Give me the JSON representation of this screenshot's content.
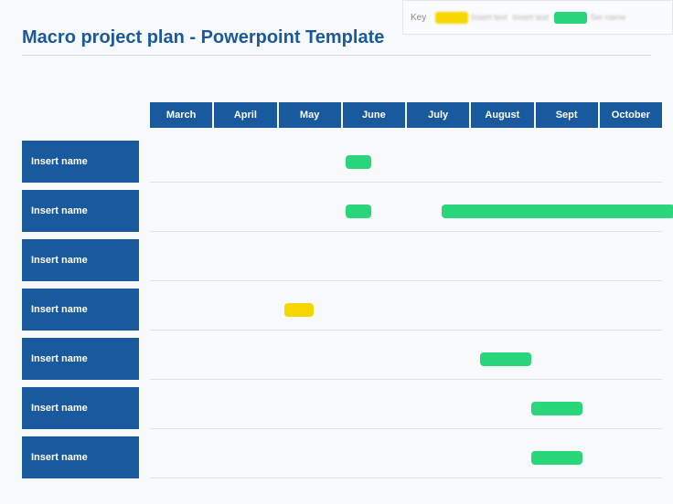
{
  "key": {
    "label": "Key",
    "items": [
      {
        "color": "yellow",
        "label": "Insert text"
      },
      {
        "color": "none",
        "label": "Insert text"
      },
      {
        "color": "green",
        "label": "Ser name"
      }
    ]
  },
  "title": "Macro project plan - Powerpoint Template",
  "months": [
    "March",
    "April",
    "May",
    "June",
    "July",
    "August",
    "Sept",
    "October"
  ],
  "rows": [
    {
      "label": "Insert name",
      "bars": [
        {
          "color": "green",
          "start": 3.05,
          "end": 3.45
        }
      ]
    },
    {
      "label": "Insert name",
      "bars": [
        {
          "color": "green",
          "start": 3.05,
          "end": 3.45
        },
        {
          "color": "green",
          "start": 4.55,
          "end": 8.2
        }
      ]
    },
    {
      "label": "Insert name",
      "bars": []
    },
    {
      "label": "Insert name",
      "bars": [
        {
          "color": "yellow",
          "start": 2.1,
          "end": 2.55
        }
      ]
    },
    {
      "label": "Insert name",
      "bars": [
        {
          "color": "green",
          "start": 5.15,
          "end": 5.95
        }
      ]
    },
    {
      "label": "Insert name",
      "bars": [
        {
          "color": "green",
          "start": 5.95,
          "end": 6.75
        }
      ]
    },
    {
      "label": "Insert name",
      "bars": [
        {
          "color": "green",
          "start": 5.95,
          "end": 6.75
        }
      ]
    }
  ]
}
